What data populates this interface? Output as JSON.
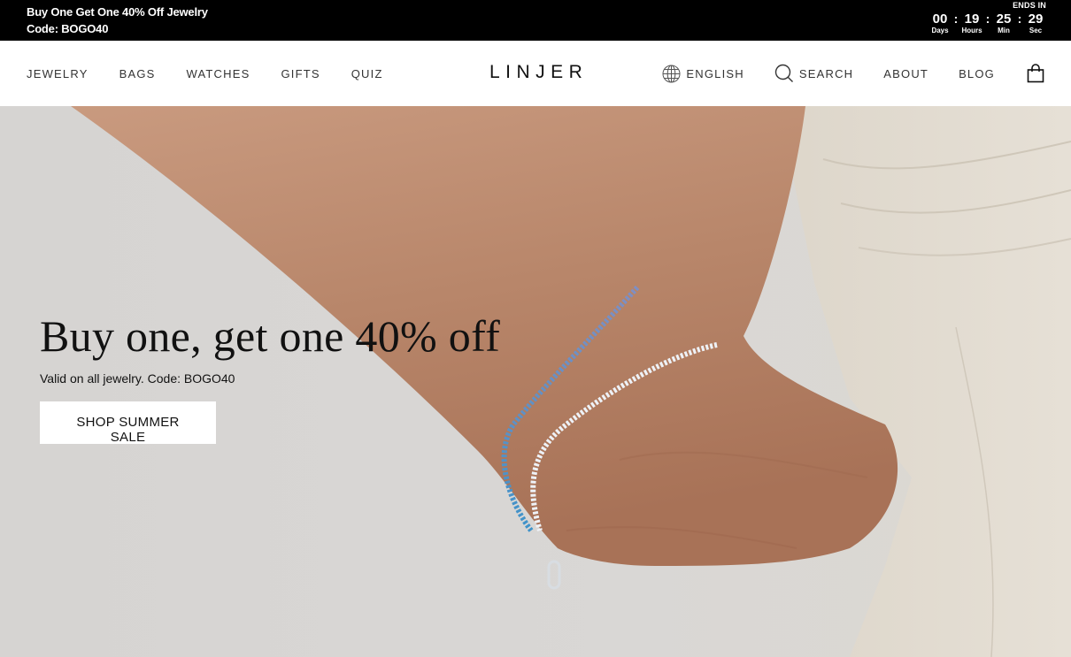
{
  "promo": {
    "line1": "Buy One Get One 40% Off Jewelry",
    "line2": "Code: BOGO40",
    "ends_in": "ENDS IN",
    "countdown": [
      {
        "value": "00",
        "label": "Days"
      },
      {
        "value": "19",
        "label": "Hours"
      },
      {
        "value": "25",
        "label": "Min"
      },
      {
        "value": "29",
        "label": "Sec"
      }
    ],
    "separator": ":"
  },
  "header": {
    "nav_left": [
      "JEWELRY",
      "BAGS",
      "WATCHES",
      "GIFTS",
      "QUIZ"
    ],
    "logo": "LINJER",
    "language": "ENGLISH",
    "search": "SEARCH",
    "about": "ABOUT",
    "blog": "BLOG",
    "icons": {
      "language": "globe-icon",
      "search": "search-icon",
      "cart": "shopping-bag-icon"
    }
  },
  "hero": {
    "title": "Buy one, get one 40% off",
    "subtitle": "Valid on all jewelry. Code: BOGO40",
    "button": "SHOP SUMMER SALE"
  },
  "colors": {
    "promo_bg": "#000000",
    "promo_text": "#ffffff",
    "hero_bg": "#d7d5d3",
    "button_bg": "#ffffff"
  }
}
